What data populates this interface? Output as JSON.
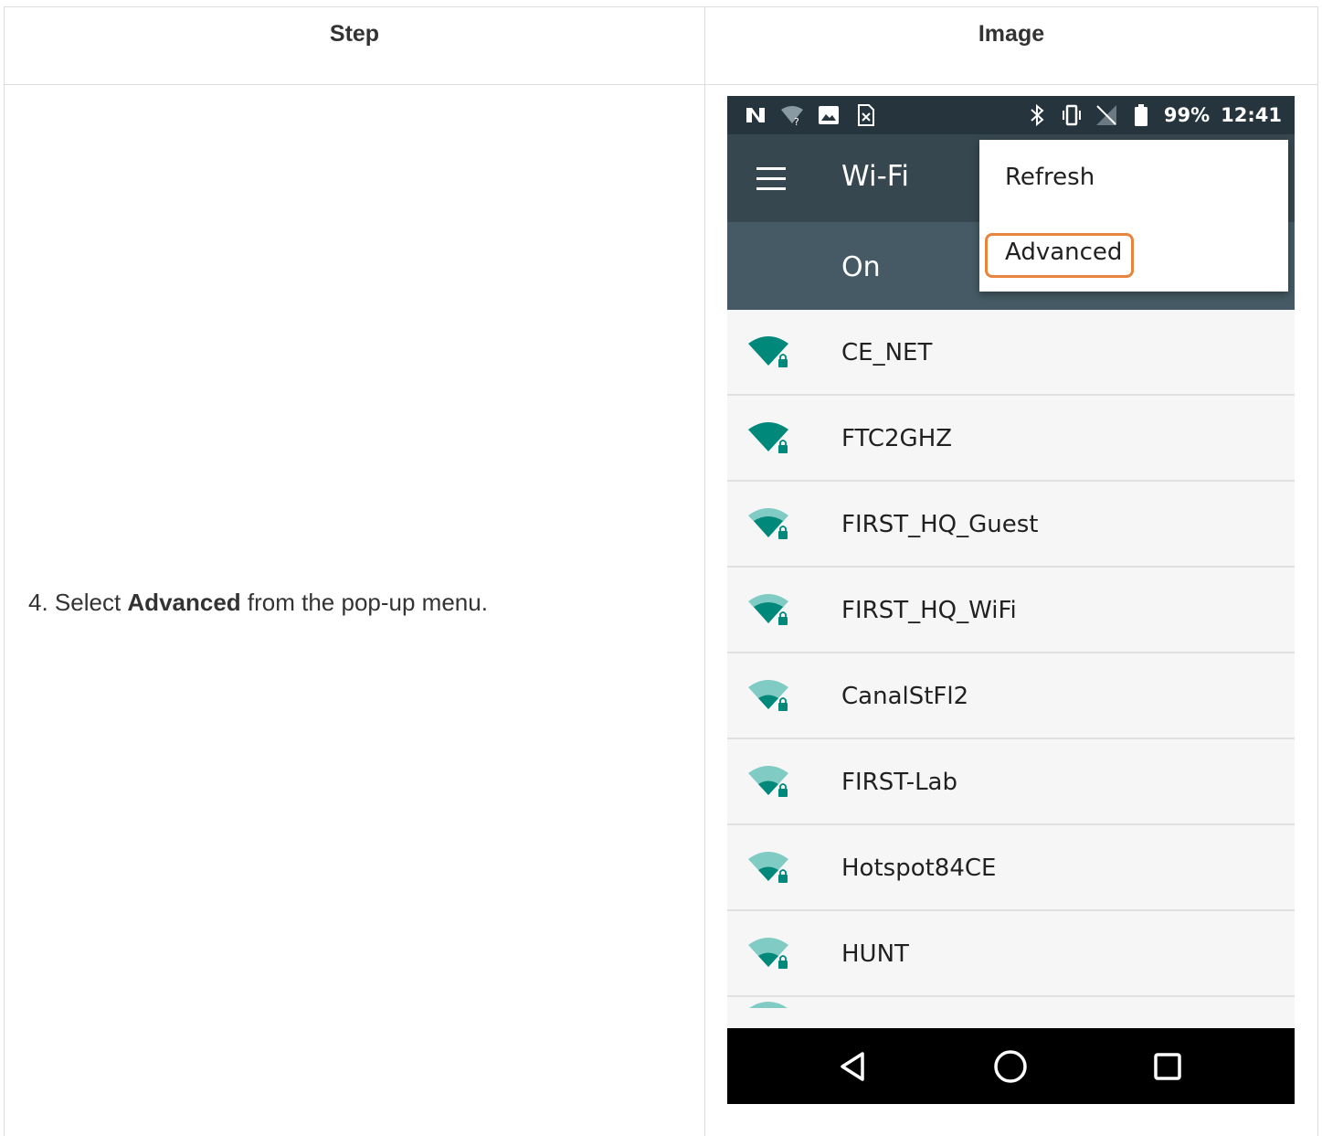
{
  "table": {
    "headers": {
      "step": "Step",
      "image": "Image"
    },
    "row": {
      "prefix": "4. Select ",
      "bold": "Advanced",
      "suffix": " from the pop-up menu."
    }
  },
  "phone": {
    "status_bar": {
      "battery_percent": "99%",
      "time": "12:41",
      "icons_left": [
        "nfc-icon",
        "wifi-unknown-icon",
        "image-icon",
        "sim-card-icon"
      ],
      "icons_right": [
        "bluetooth-icon",
        "vibrate-icon",
        "no-signal-icon",
        "battery-icon"
      ]
    },
    "app_bar": {
      "title": "Wi-Fi"
    },
    "switch_bar": {
      "label": "On"
    },
    "menu": {
      "items": [
        "Refresh",
        "Advanced"
      ],
      "highlight_color": "#e8843d"
    },
    "networks": [
      {
        "name": "CE_NET",
        "strength": "strong"
      },
      {
        "name": "FTC2GHZ",
        "strength": "strong"
      },
      {
        "name": "FIRST_HQ_Guest",
        "strength": "medium"
      },
      {
        "name": "FIRST_HQ_WiFi",
        "strength": "medium"
      },
      {
        "name": "CanalStFl2",
        "strength": "weak"
      },
      {
        "name": "FIRST-Lab",
        "strength": "weak"
      },
      {
        "name": "Hotspot84CE",
        "strength": "weak"
      },
      {
        "name": "HUNT",
        "strength": "weak"
      }
    ],
    "colors": {
      "accent": "#00897b",
      "accent_light": "#80cbc4",
      "app_bar": "#37474f",
      "status_bar": "#26353d"
    }
  }
}
